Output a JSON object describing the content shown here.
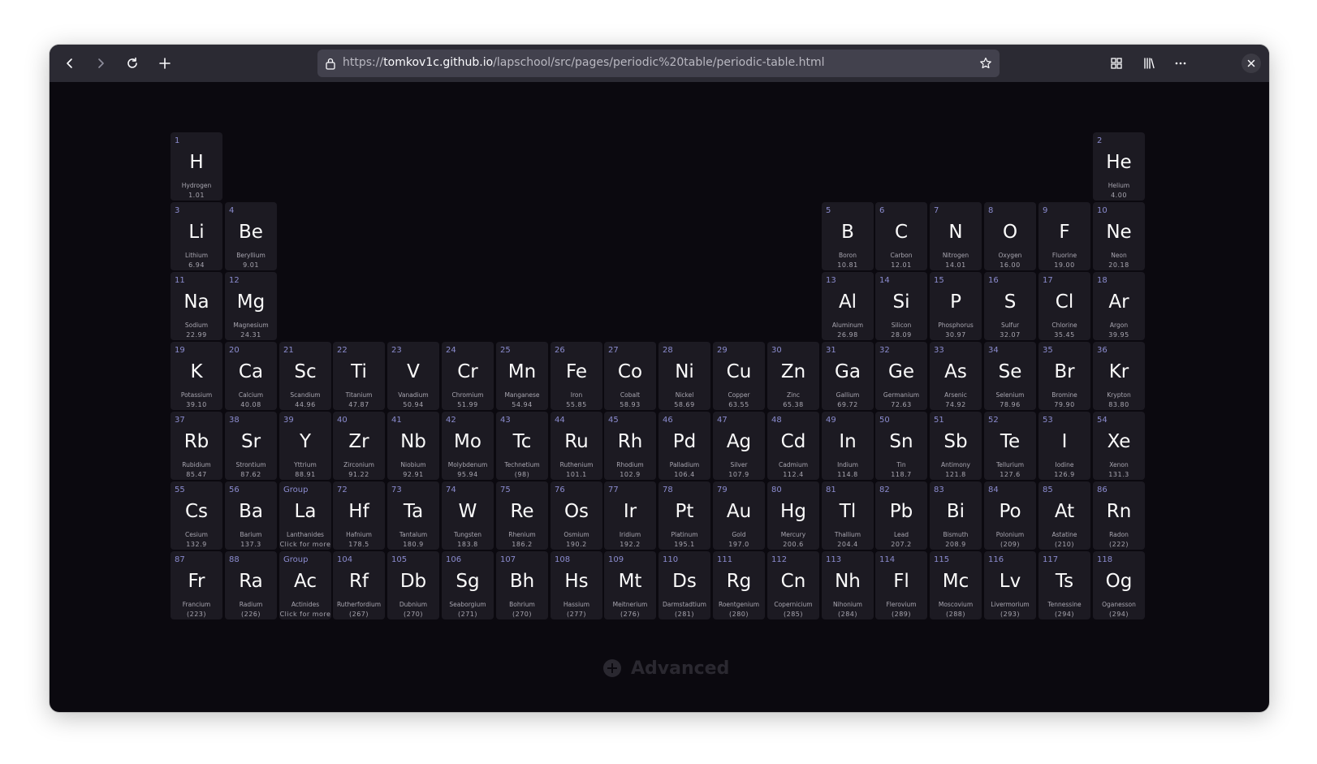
{
  "browser": {
    "url_prefix": "https://",
    "url_host": "tomkov1c.github.io",
    "url_path": "/lapschool/src/pages/periodic%20table/periodic-table.html",
    "icons": [
      "back-icon",
      "forward-icon",
      "reload-icon",
      "new-tab-icon",
      "lock-icon",
      "bookmark-star-icon",
      "extensions-grid-icon",
      "library-icon",
      "menu-dots-icon",
      "close-icon"
    ]
  },
  "advanced_label": "Advanced",
  "elements": [
    {
      "num": "1",
      "sym": "H",
      "name": "Hydrogen",
      "mass": "1.01",
      "row": 1,
      "col": 1
    },
    {
      "num": "2",
      "sym": "He",
      "name": "Helium",
      "mass": "4.00",
      "row": 1,
      "col": 18
    },
    {
      "num": "3",
      "sym": "Li",
      "name": "Lithium",
      "mass": "6.94",
      "row": 2,
      "col": 1
    },
    {
      "num": "4",
      "sym": "Be",
      "name": "Beryllium",
      "mass": "9.01",
      "row": 2,
      "col": 2
    },
    {
      "num": "5",
      "sym": "B",
      "name": "Boron",
      "mass": "10.81",
      "row": 2,
      "col": 13
    },
    {
      "num": "6",
      "sym": "C",
      "name": "Carbon",
      "mass": "12.01",
      "row": 2,
      "col": 14
    },
    {
      "num": "7",
      "sym": "N",
      "name": "Nitrogen",
      "mass": "14.01",
      "row": 2,
      "col": 15
    },
    {
      "num": "8",
      "sym": "O",
      "name": "Oxygen",
      "mass": "16.00",
      "row": 2,
      "col": 16
    },
    {
      "num": "9",
      "sym": "F",
      "name": "Fluorine",
      "mass": "19.00",
      "row": 2,
      "col": 17
    },
    {
      "num": "10",
      "sym": "Ne",
      "name": "Neon",
      "mass": "20.18",
      "row": 2,
      "col": 18
    },
    {
      "num": "11",
      "sym": "Na",
      "name": "Sodium",
      "mass": "22.99",
      "row": 3,
      "col": 1
    },
    {
      "num": "12",
      "sym": "Mg",
      "name": "Magnesium",
      "mass": "24.31",
      "row": 3,
      "col": 2
    },
    {
      "num": "13",
      "sym": "Al",
      "name": "Aluminum",
      "mass": "26.98",
      "row": 3,
      "col": 13
    },
    {
      "num": "14",
      "sym": "Si",
      "name": "Silicon",
      "mass": "28.09",
      "row": 3,
      "col": 14
    },
    {
      "num": "15",
      "sym": "P",
      "name": "Phosphorus",
      "mass": "30.97",
      "row": 3,
      "col": 15
    },
    {
      "num": "16",
      "sym": "S",
      "name": "Sulfur",
      "mass": "32.07",
      "row": 3,
      "col": 16
    },
    {
      "num": "17",
      "sym": "Cl",
      "name": "Chlorine",
      "mass": "35.45",
      "row": 3,
      "col": 17
    },
    {
      "num": "18",
      "sym": "Ar",
      "name": "Argon",
      "mass": "39.95",
      "row": 3,
      "col": 18
    },
    {
      "num": "19",
      "sym": "K",
      "name": "Potassium",
      "mass": "39.10",
      "row": 4,
      "col": 1
    },
    {
      "num": "20",
      "sym": "Ca",
      "name": "Calcium",
      "mass": "40.08",
      "row": 4,
      "col": 2
    },
    {
      "num": "21",
      "sym": "Sc",
      "name": "Scandium",
      "mass": "44.96",
      "row": 4,
      "col": 3
    },
    {
      "num": "22",
      "sym": "Ti",
      "name": "Titanium",
      "mass": "47.87",
      "row": 4,
      "col": 4
    },
    {
      "num": "23",
      "sym": "V",
      "name": "Vanadium",
      "mass": "50.94",
      "row": 4,
      "col": 5
    },
    {
      "num": "24",
      "sym": "Cr",
      "name": "Chromium",
      "mass": "51.99",
      "row": 4,
      "col": 6
    },
    {
      "num": "25",
      "sym": "Mn",
      "name": "Manganese",
      "mass": "54.94",
      "row": 4,
      "col": 7
    },
    {
      "num": "26",
      "sym": "Fe",
      "name": "Iron",
      "mass": "55.85",
      "row": 4,
      "col": 8
    },
    {
      "num": "27",
      "sym": "Co",
      "name": "Cobalt",
      "mass": "58.93",
      "row": 4,
      "col": 9
    },
    {
      "num": "28",
      "sym": "Ni",
      "name": "Nickel",
      "mass": "58.69",
      "row": 4,
      "col": 10
    },
    {
      "num": "29",
      "sym": "Cu",
      "name": "Copper",
      "mass": "63.55",
      "row": 4,
      "col": 11
    },
    {
      "num": "30",
      "sym": "Zn",
      "name": "Zinc",
      "mass": "65.38",
      "row": 4,
      "col": 12
    },
    {
      "num": "31",
      "sym": "Ga",
      "name": "Gallium",
      "mass": "69.72",
      "row": 4,
      "col": 13
    },
    {
      "num": "32",
      "sym": "Ge",
      "name": "Germanium",
      "mass": "72.63",
      "row": 4,
      "col": 14
    },
    {
      "num": "33",
      "sym": "As",
      "name": "Arsenic",
      "mass": "74.92",
      "row": 4,
      "col": 15
    },
    {
      "num": "34",
      "sym": "Se",
      "name": "Selenium",
      "mass": "78.96",
      "row": 4,
      "col": 16
    },
    {
      "num": "35",
      "sym": "Br",
      "name": "Bromine",
      "mass": "79.90",
      "row": 4,
      "col": 17
    },
    {
      "num": "36",
      "sym": "Kr",
      "name": "Krypton",
      "mass": "83.80",
      "row": 4,
      "col": 18
    },
    {
      "num": "37",
      "sym": "Rb",
      "name": "Rubidium",
      "mass": "85.47",
      "row": 5,
      "col": 1
    },
    {
      "num": "38",
      "sym": "Sr",
      "name": "Strontium",
      "mass": "87.62",
      "row": 5,
      "col": 2
    },
    {
      "num": "39",
      "sym": "Y",
      "name": "Yttrium",
      "mass": "88.91",
      "row": 5,
      "col": 3
    },
    {
      "num": "40",
      "sym": "Zr",
      "name": "Zirconium",
      "mass": "91.22",
      "row": 5,
      "col": 4
    },
    {
      "num": "41",
      "sym": "Nb",
      "name": "Niobium",
      "mass": "92.91",
      "row": 5,
      "col": 5
    },
    {
      "num": "42",
      "sym": "Mo",
      "name": "Molybdenum",
      "mass": "95.94",
      "row": 5,
      "col": 6
    },
    {
      "num": "43",
      "sym": "Tc",
      "name": "Technetium",
      "mass": "(98)",
      "row": 5,
      "col": 7
    },
    {
      "num": "44",
      "sym": "Ru",
      "name": "Ruthenium",
      "mass": "101.1",
      "row": 5,
      "col": 8
    },
    {
      "num": "45",
      "sym": "Rh",
      "name": "Rhodium",
      "mass": "102.9",
      "row": 5,
      "col": 9
    },
    {
      "num": "46",
      "sym": "Pd",
      "name": "Palladium",
      "mass": "106.4",
      "row": 5,
      "col": 10
    },
    {
      "num": "47",
      "sym": "Ag",
      "name": "Silver",
      "mass": "107.9",
      "row": 5,
      "col": 11
    },
    {
      "num": "48",
      "sym": "Cd",
      "name": "Cadmium",
      "mass": "112.4",
      "row": 5,
      "col": 12
    },
    {
      "num": "49",
      "sym": "In",
      "name": "Indium",
      "mass": "114.8",
      "row": 5,
      "col": 13
    },
    {
      "num": "50",
      "sym": "Sn",
      "name": "Tin",
      "mass": "118.7",
      "row": 5,
      "col": 14
    },
    {
      "num": "51",
      "sym": "Sb",
      "name": "Antimony",
      "mass": "121.8",
      "row": 5,
      "col": 15
    },
    {
      "num": "52",
      "sym": "Te",
      "name": "Tellurium",
      "mass": "127.6",
      "row": 5,
      "col": 16
    },
    {
      "num": "53",
      "sym": "I",
      "name": "Iodine",
      "mass": "126.9",
      "row": 5,
      "col": 17
    },
    {
      "num": "54",
      "sym": "Xe",
      "name": "Xenon",
      "mass": "131.3",
      "row": 5,
      "col": 18
    },
    {
      "num": "55",
      "sym": "Cs",
      "name": "Cesium",
      "mass": "132.9",
      "row": 6,
      "col": 1
    },
    {
      "num": "56",
      "sym": "Ba",
      "name": "Barium",
      "mass": "137.3",
      "row": 6,
      "col": 2
    },
    {
      "num": "Group",
      "sym": "La",
      "name": "Lanthanides",
      "mass": "Click for more",
      "row": 6,
      "col": 3
    },
    {
      "num": "72",
      "sym": "Hf",
      "name": "Hafnium",
      "mass": "178.5",
      "row": 6,
      "col": 4
    },
    {
      "num": "73",
      "sym": "Ta",
      "name": "Tantalum",
      "mass": "180.9",
      "row": 6,
      "col": 5
    },
    {
      "num": "74",
      "sym": "W",
      "name": "Tungsten",
      "mass": "183.8",
      "row": 6,
      "col": 6
    },
    {
      "num": "75",
      "sym": "Re",
      "name": "Rhenium",
      "mass": "186.2",
      "row": 6,
      "col": 7
    },
    {
      "num": "76",
      "sym": "Os",
      "name": "Osmium",
      "mass": "190.2",
      "row": 6,
      "col": 8
    },
    {
      "num": "77",
      "sym": "Ir",
      "name": "Iridium",
      "mass": "192.2",
      "row": 6,
      "col": 9
    },
    {
      "num": "78",
      "sym": "Pt",
      "name": "Platinum",
      "mass": "195.1",
      "row": 6,
      "col": 10
    },
    {
      "num": "79",
      "sym": "Au",
      "name": "Gold",
      "mass": "197.0",
      "row": 6,
      "col": 11
    },
    {
      "num": "80",
      "sym": "Hg",
      "name": "Mercury",
      "mass": "200.6",
      "row": 6,
      "col": 12
    },
    {
      "num": "81",
      "sym": "Tl",
      "name": "Thallium",
      "mass": "204.4",
      "row": 6,
      "col": 13
    },
    {
      "num": "82",
      "sym": "Pb",
      "name": "Lead",
      "mass": "207.2",
      "row": 6,
      "col": 14
    },
    {
      "num": "83",
      "sym": "Bi",
      "name": "Bismuth",
      "mass": "208.9",
      "row": 6,
      "col": 15
    },
    {
      "num": "84",
      "sym": "Po",
      "name": "Polonium",
      "mass": "(209)",
      "row": 6,
      "col": 16
    },
    {
      "num": "85",
      "sym": "At",
      "name": "Astatine",
      "mass": "(210)",
      "row": 6,
      "col": 17
    },
    {
      "num": "86",
      "sym": "Rn",
      "name": "Radon",
      "mass": "(222)",
      "row": 6,
      "col": 18
    },
    {
      "num": "87",
      "sym": "Fr",
      "name": "Francium",
      "mass": "(223)",
      "row": 7,
      "col": 1
    },
    {
      "num": "88",
      "sym": "Ra",
      "name": "Radium",
      "mass": "(226)",
      "row": 7,
      "col": 2
    },
    {
      "num": "Group",
      "sym": "Ac",
      "name": "Actinides",
      "mass": "Click for more",
      "row": 7,
      "col": 3
    },
    {
      "num": "104",
      "sym": "Rf",
      "name": "Rutherfordium",
      "mass": "(267)",
      "row": 7,
      "col": 4
    },
    {
      "num": "105",
      "sym": "Db",
      "name": "Dubnium",
      "mass": "(270)",
      "row": 7,
      "col": 5
    },
    {
      "num": "106",
      "sym": "Sg",
      "name": "Seaborgium",
      "mass": "(271)",
      "row": 7,
      "col": 6
    },
    {
      "num": "107",
      "sym": "Bh",
      "name": "Bohrium",
      "mass": "(270)",
      "row": 7,
      "col": 7
    },
    {
      "num": "108",
      "sym": "Hs",
      "name": "Hassium",
      "mass": "(277)",
      "row": 7,
      "col": 8
    },
    {
      "num": "109",
      "sym": "Mt",
      "name": "Meitnerium",
      "mass": "(276)",
      "row": 7,
      "col": 9
    },
    {
      "num": "110",
      "sym": "Ds",
      "name": "Darmstadtium",
      "mass": "(281)",
      "row": 7,
      "col": 10
    },
    {
      "num": "111",
      "sym": "Rg",
      "name": "Roentgenium",
      "mass": "(280)",
      "row": 7,
      "col": 11
    },
    {
      "num": "112",
      "sym": "Cn",
      "name": "Copernicium",
      "mass": "(285)",
      "row": 7,
      "col": 12
    },
    {
      "num": "113",
      "sym": "Nh",
      "name": "Nihonium",
      "mass": "(284)",
      "row": 7,
      "col": 13
    },
    {
      "num": "114",
      "sym": "Fl",
      "name": "Flerovium",
      "mass": "(289)",
      "row": 7,
      "col": 14
    },
    {
      "num": "115",
      "sym": "Mc",
      "name": "Moscovium",
      "mass": "(288)",
      "row": 7,
      "col": 15
    },
    {
      "num": "116",
      "sym": "Lv",
      "name": "Livermorium",
      "mass": "(293)",
      "row": 7,
      "col": 16
    },
    {
      "num": "117",
      "sym": "Ts",
      "name": "Tennessine",
      "mass": "(294)",
      "row": 7,
      "col": 17
    },
    {
      "num": "118",
      "sym": "Og",
      "name": "Oganesson",
      "mass": "(294)",
      "row": 7,
      "col": 18
    }
  ]
}
